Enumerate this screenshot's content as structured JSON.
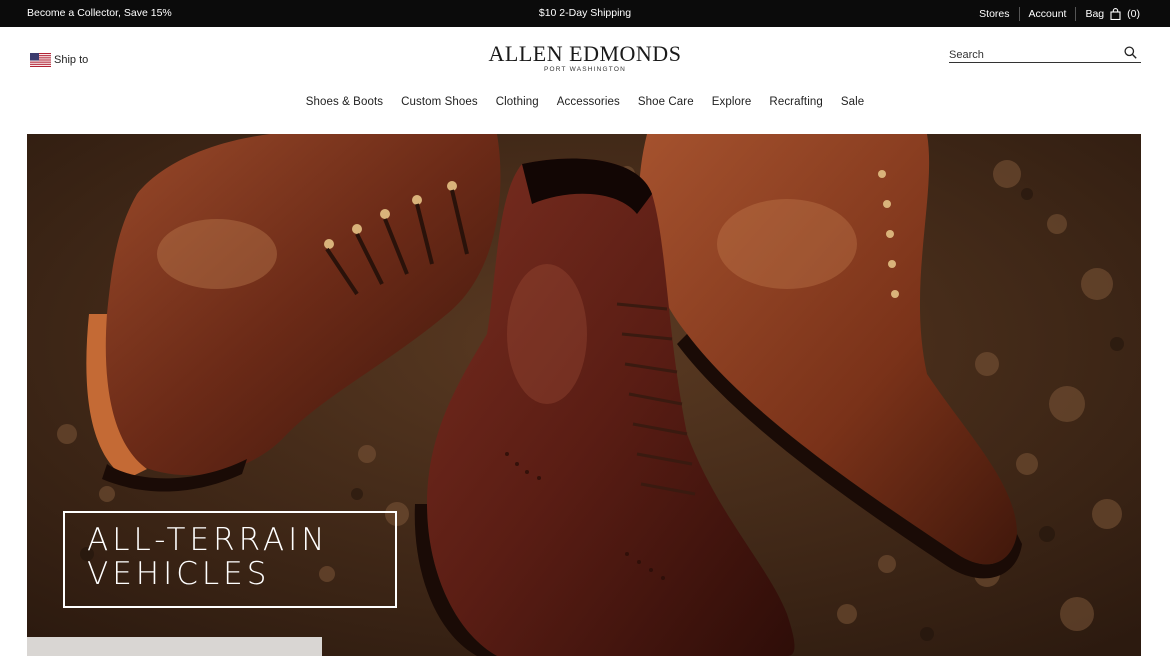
{
  "topbar": {
    "promo_left": "Become a Collector, Save 15%",
    "promo_center": "$10 2-Day Shipping",
    "stores": "Stores",
    "account": "Account",
    "bag": "Bag",
    "bag_count": "(0)"
  },
  "header": {
    "ship_to": "Ship to",
    "brand": "ALLEN EDMONDS",
    "brand_sub": "PORT WASHINGTON",
    "search_placeholder": "Search"
  },
  "nav": {
    "items": [
      {
        "label": "Shoes & Boots"
      },
      {
        "label": "Custom Shoes"
      },
      {
        "label": "Clothing"
      },
      {
        "label": "Accessories"
      },
      {
        "label": "Shoe Care"
      },
      {
        "label": "Explore"
      },
      {
        "label": "Recrafting"
      },
      {
        "label": "Sale"
      }
    ]
  },
  "hero": {
    "headline_line1": "ALL-TERRAIN",
    "headline_line2": "VEHICLES"
  },
  "colors": {
    "topbar_bg": "#0b0b0b",
    "soil": "#3b2516",
    "leather": "#6a2a16"
  },
  "icons": [
    "flag-us-icon",
    "bag-icon",
    "search-icon"
  ]
}
